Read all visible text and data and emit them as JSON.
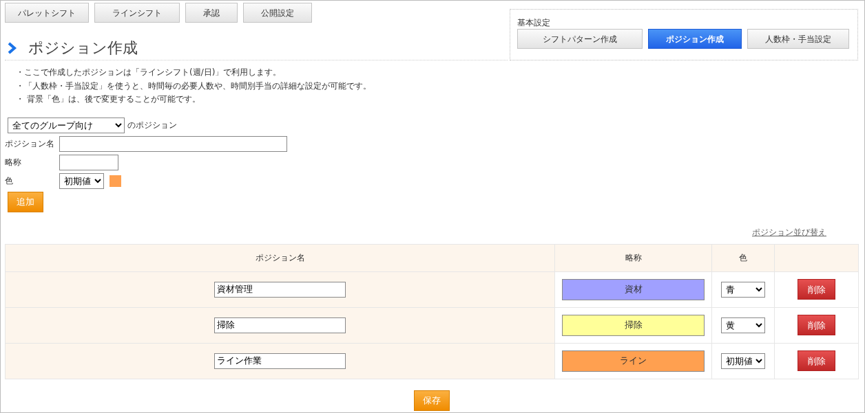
{
  "top_tabs": [
    {
      "label": "パレットシフト"
    },
    {
      "label": "ラインシフト"
    },
    {
      "label": "承認"
    },
    {
      "label": "公開設定"
    }
  ],
  "basic_settings": {
    "label": "基本設定",
    "tabs": [
      {
        "label": "シフトパターン作成",
        "selected": false
      },
      {
        "label": "ポジション作成",
        "selected": true
      },
      {
        "label": "人数枠・手当設定",
        "selected": false
      }
    ]
  },
  "page_title": "ポジション作成",
  "notes": [
    "・ここで作成したポジションは「ラインシフト(週/日)」で利用します。",
    "・「人数枠・手当設定」を使うと、時間毎の必要人数や、時間別手当の詳細な設定が可能です。",
    "・ 背景「色」は、後で変更することが可能です。"
  ],
  "form": {
    "group_select": "全てのグループ向け",
    "group_suffix": "のポジション",
    "name_label": "ポジション名",
    "short_label": "略称",
    "color_label": "色",
    "color_select": "初期値",
    "color": "#ffa050",
    "add_button": "追加"
  },
  "sort_link": "ポジション並び替え",
  "table": {
    "columns": [
      "ポジション名",
      "略称",
      "色"
    ],
    "rows": [
      {
        "name": "資材管理",
        "short": "資材",
        "color_name": "青",
        "color": "#a0a0ff",
        "delete": "削除"
      },
      {
        "name": "掃除",
        "short": "掃除",
        "color_name": "黄",
        "color": "#ffff99",
        "delete": "削除"
      },
      {
        "name": "ライン作業",
        "short": "ライン",
        "color_name": "初期値",
        "color": "#ffa050",
        "delete": "削除"
      }
    ]
  },
  "save_button": "保存"
}
